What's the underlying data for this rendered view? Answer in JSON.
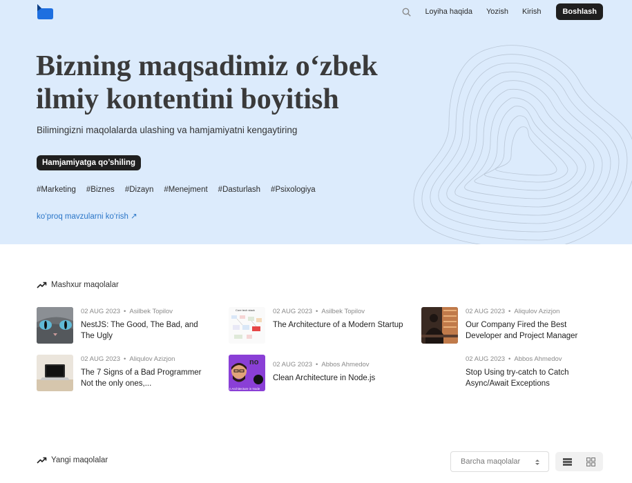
{
  "nav": {
    "about": "Loyiha haqida",
    "write": "Yozish",
    "login": "Kirish",
    "start": "Boshlash"
  },
  "hero": {
    "title_line1": "Bizning maqsadimiz o‘zbek",
    "title_line2": "ilmiy kontentini boyitish",
    "subtitle": "Bilimingizni maqolalarda ulashing va hamjamiyatni kengaytiring",
    "join_button": "Hamjamiyatga qo’shiling",
    "tags": [
      "#Marketing",
      "#Biznes",
      "#Dizayn",
      "#Menejment",
      "#Dasturlash",
      "#Psixologiya"
    ],
    "more_link": "ko‘proq mavzularni ko‘rish ↗"
  },
  "popular": {
    "heading": "Mashxur maqolalar",
    "articles": [
      {
        "date": "02 AUG 2023",
        "author": "Asilbek Topilov",
        "title": "NestJS: The Good, The Bad, and The Ugly"
      },
      {
        "date": "02 AUG 2023",
        "author": "Asilbek Topilov",
        "title": "The Architecture of a Modern Startup"
      },
      {
        "date": "02 AUG 2023",
        "author": "Aliqulov Azizjon",
        "title": "Our Company Fired the Best Developer and Project Manager"
      },
      {
        "date": "02 AUG 2023",
        "author": "Aliqulov Azizjon",
        "title": "The 7 Signs of a Bad Programmer Not the only ones,..."
      },
      {
        "date": "02 AUG 2023",
        "author": "Abbos Ahmedov",
        "title": "Clean Architecture in Node.js"
      },
      {
        "date": "02 AUG 2023",
        "author": "Abbos Ahmedov",
        "title": "Stop Using try-catch to Catch Async/Await Exceptions"
      }
    ]
  },
  "recent": {
    "heading": "Yangi maqolalar",
    "filter_value": "Barcha maqolalar"
  },
  "thumb_texts": {
    "startup_diagram": "Core tech stack",
    "node_banner": "n Architecture in Node"
  },
  "colors": {
    "hero_bg": "#dcebfc",
    "brand_blue": "#1e6fe0",
    "link_blue": "#2b76c8",
    "dark_button": "#1f1f1f"
  }
}
